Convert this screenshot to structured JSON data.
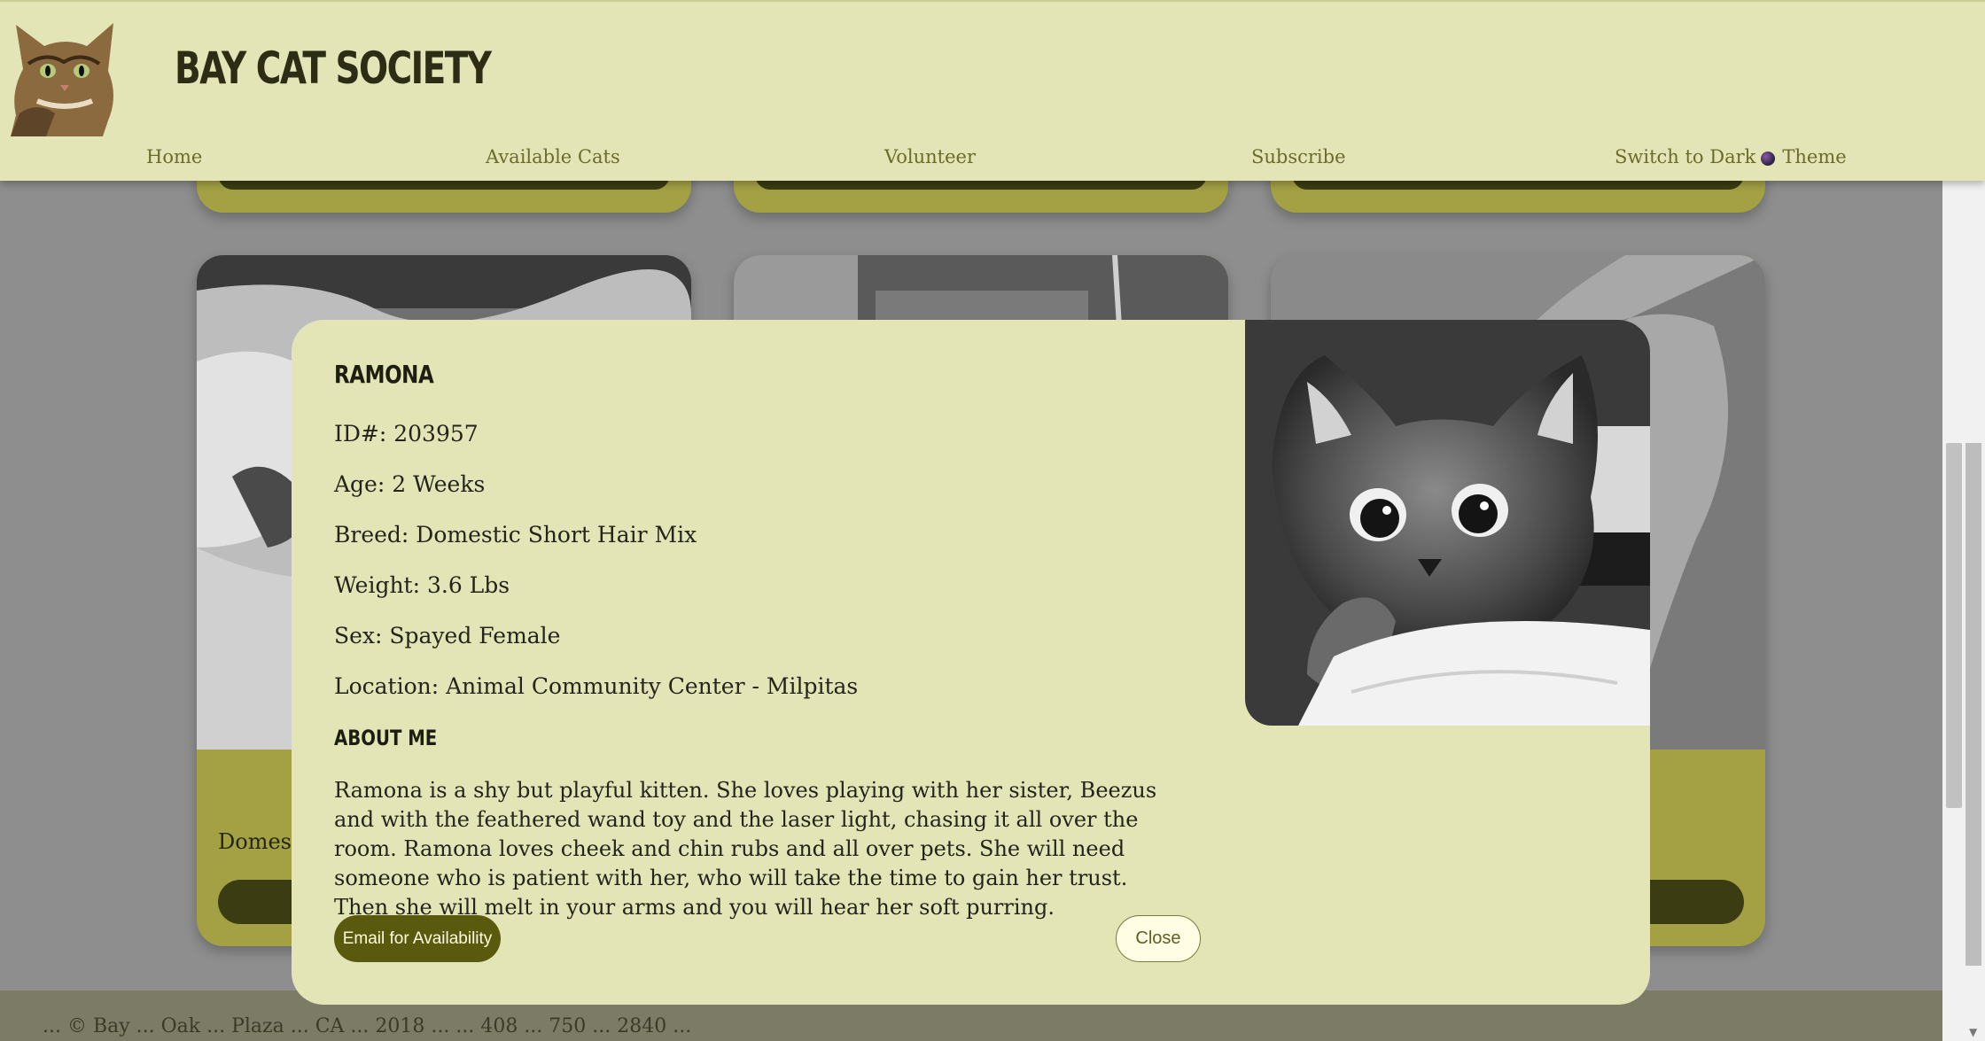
{
  "header": {
    "title": "BAY CAT SOCIETY",
    "logo_icon": "cat-logo-icon"
  },
  "nav": {
    "home": "Home",
    "available_cats": "Available Cats",
    "volunteer": "Volunteer",
    "subscribe": "Subscribe",
    "theme_prefix": "Switch to Dark",
    "theme_suffix": "Theme"
  },
  "background_cards": {
    "visible_text": "Domesti"
  },
  "footer": {
    "text": "... © Bay ... Oak ... Plaza ... CA ... 2018 ... ... 408 ... 750 ... 2840 ..."
  },
  "modal": {
    "name": "RAMONA",
    "id": "ID#: 203957",
    "age": "Age: 2 Weeks",
    "breed": "Breed: Domestic Short Hair Mix",
    "weight": "Weight: 3.6 Lbs",
    "sex": "Sex: Spayed Female",
    "location": "Location: Animal Community Center - Milpitas",
    "about_heading": "ABOUT ME",
    "about_text": "Ramona is a shy but playful kitten. She loves playing with her sister, Beezus and with the feathered wand toy and the laser light, chasing it all over the room. Ramona loves cheek and chin rubs and all over pets. She will need someone who is patient with her, who will take the time to gain her trust. Then she will melt in your arms and you will hear her soft purring.",
    "email_button": "Email for Availability",
    "close_button": "Close",
    "photo_icon": "kitten-photo"
  },
  "colors": {
    "header_bg": "#e3e5b7",
    "card_bg": "#a3a144",
    "button_dark": "#5a5a0e",
    "overlay": "#8e8e8e"
  }
}
